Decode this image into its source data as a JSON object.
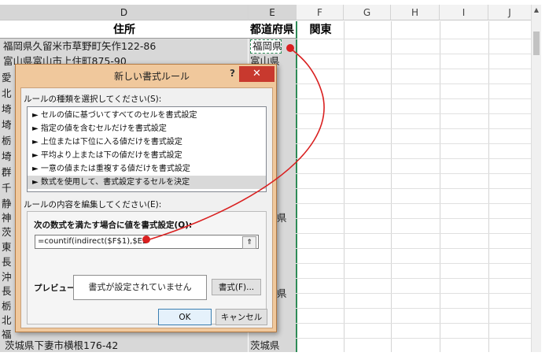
{
  "columns": [
    "D",
    "E",
    "F",
    "G",
    "H",
    "I",
    "J"
  ],
  "header_row": {
    "d": "住所",
    "e": "都道府県",
    "f": "関東"
  },
  "rows": [
    {
      "address": "福岡県久留米市草野町矢作122-86",
      "pref": "福岡県"
    },
    {
      "address": "富山県富山市上住町875-90",
      "pref": "富山県"
    }
  ],
  "partial_rows": [
    {
      "lead": "愛",
      "pref": ""
    },
    {
      "lead": "北",
      "pref": ""
    },
    {
      "lead": "埼",
      "pref": ""
    },
    {
      "lead": "埼",
      "pref": ""
    },
    {
      "lead": "栃",
      "pref": ""
    },
    {
      "lead": "埼",
      "pref": ""
    },
    {
      "lead": "群",
      "pref": ""
    },
    {
      "lead": "千",
      "pref": ""
    },
    {
      "lead": "静",
      "pref": ""
    },
    {
      "lead": "神",
      "pref": "県"
    },
    {
      "lead": "茨",
      "pref": ""
    },
    {
      "lead": "東",
      "pref": ""
    },
    {
      "lead": "長",
      "pref": ""
    },
    {
      "lead": "沖",
      "pref": ""
    },
    {
      "lead": "長",
      "pref": ""
    },
    {
      "lead": "栃",
      "pref": "県"
    },
    {
      "lead": "北",
      "pref": ""
    },
    {
      "lead": "福",
      "pref": ""
    }
  ],
  "last_row": {
    "address": "茨城県下妻市横根176-42",
    "pref": "茨城県"
  },
  "dialog": {
    "title": "新しい書式ルール",
    "help": "?",
    "close": "✕",
    "rule_type_label": "ルールの種類を選択してください(S):",
    "rule_types": [
      "► セルの値に基づいてすべてのセルを書式設定",
      "► 指定の値を含むセルだけを書式設定",
      "► 上位または下位に入る値だけを書式設定",
      "► 平均より上または下の値だけを書式設定",
      "► 一意の値または重複する値だけを書式設定",
      "► 数式を使用して、書式設定するセルを決定"
    ],
    "edit_label": "ルールの内容を編集してください(E):",
    "formula_label": "次の数式を満たす場合に値を書式設定(O):",
    "formula_value": "=countif(indirect($F$1),$E2",
    "formula_button": "⇑",
    "preview_label": "プレビュー:",
    "preview_text": "書式が設定されていません",
    "format_button": "書式(F)...",
    "ok_button": "OK",
    "cancel_button": "キャンセル"
  },
  "colors": {
    "accent": "#d92020",
    "dialog_frame": "#f0c89c",
    "close": "#c8392e",
    "selected_fill": "#d8d8d8",
    "dash": "#2e8b57"
  }
}
